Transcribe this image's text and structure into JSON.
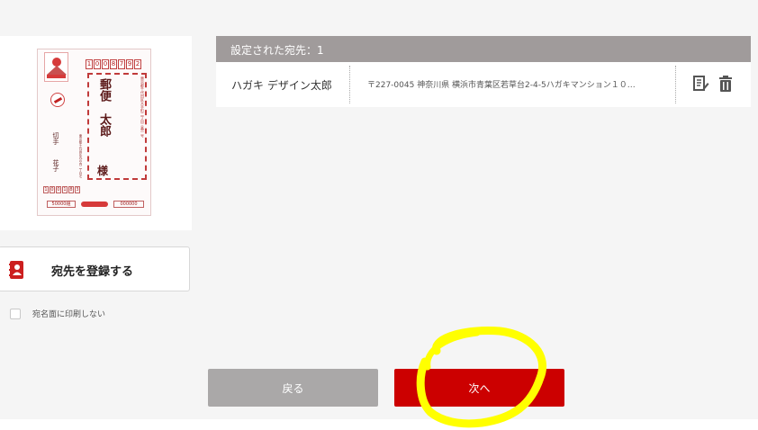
{
  "colors": {
    "accent_red": "#cc0000",
    "header_gray": "#a09b9b",
    "back_gray": "#aaa8a8",
    "annotation_yellow": "#ffff00"
  },
  "postcard": {
    "zip_digits": [
      "1",
      "0",
      "0",
      "8",
      "7",
      "9",
      "2"
    ],
    "recipient_name": "郵便　太郎",
    "recipient_honorific": "様",
    "recipient_address": "東京都千代田区大手町二丁目三番一号",
    "sender_name_first": "切手",
    "sender_name_second": "花子",
    "sender_address": "東京都千代田区丸の内二丁目七番二号",
    "sender_zip": [
      "1",
      "0",
      "0",
      "1",
      "8",
      "3"
    ],
    "lottery_left": "50000組",
    "lottery_right": "000000"
  },
  "register": {
    "icon": "address-book-icon",
    "label": "宛先を登録する"
  },
  "no_print": {
    "label": "宛名面に印刷しない",
    "checked": false
  },
  "table": {
    "header": "設定された宛先：1",
    "rows": [
      {
        "name": "ハガキ デザイン太郎",
        "address": "〒227-0045 神奈川県 横浜市青葉区若草台2-4-5ハガキマンション１０…",
        "edit_icon": "edit-icon",
        "delete_icon": "trash-icon"
      }
    ]
  },
  "nav": {
    "back_label": "戻る",
    "next_label": "次へ"
  }
}
